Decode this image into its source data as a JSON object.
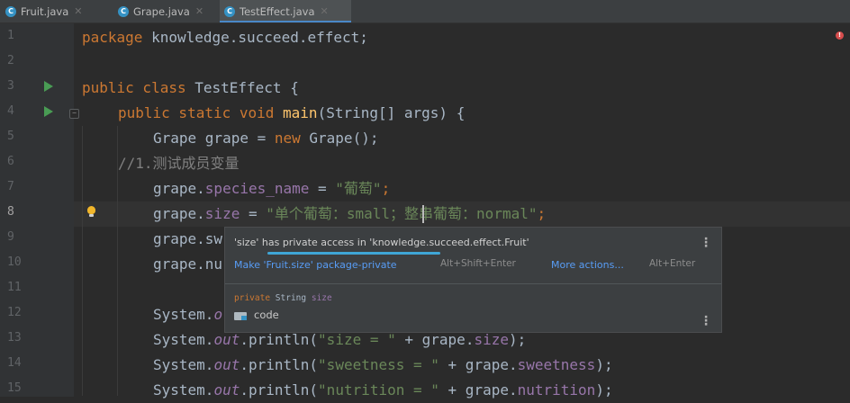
{
  "tabs": [
    {
      "label": "Fruit.java",
      "icon": "c-class-icon",
      "active": false
    },
    {
      "label": "Grape.java",
      "icon": "c-class-icon",
      "active": false
    },
    {
      "label": "TestEffect.java",
      "icon": "c-class-icon",
      "active": true
    }
  ],
  "line_numbers": [
    "1",
    "2",
    "3",
    "4",
    "5",
    "6",
    "7",
    "8",
    "9",
    "10",
    "11",
    "12",
    "13",
    "14",
    "15"
  ],
  "current_line": "8",
  "code": {
    "l1_kw": "package",
    "l1_rest": " knowledge.succeed.effect;",
    "l3_kw": "public class",
    "l3_rest": " TestEffect {",
    "l4_kw1": "public static void",
    "l4_fn": "main",
    "l4_rest": "(String[] args) {",
    "l5_a": "Grape grape = ",
    "l5_kw": "new",
    "l5_b": " Grape();",
    "l6_cmt": "//1.测试成员变量",
    "l7_a": "grape.",
    "l7_fld": "species_name",
    "l7_b": " = ",
    "l7_str": "\"葡萄\"",
    "l7_c": ";",
    "l8_a": "grape.",
    "l8_fld": "size",
    "l8_b": " = ",
    "l8_str1": "\"单个葡萄：small；",
    "l8_str2": "整串葡萄：normal\"",
    "l8_c": ";",
    "l9_a": "grape.sw",
    "l10_a": "grape.nu",
    "l12_a": "System.",
    "l12_out": "o",
    "l13_a": "System.",
    "l13_out": "out",
    "l13_b": ".println(",
    "l13_str": "\"size = \"",
    "l13_c": " + grape.",
    "l13_fld": "size",
    "l13_d": ");",
    "l14_a": "System.",
    "l14_out": "out",
    "l14_b": ".println(",
    "l14_str": "\"sweetness = \"",
    "l14_c": " + grape.",
    "l14_fld": "sweetness",
    "l14_d": ");",
    "l15_a": "System.",
    "l15_out": "out",
    "l15_b": ".println(",
    "l15_str": "\"nutrition = \"",
    "l15_c": " + grape.",
    "l15_fld": "nutrition",
    "l15_d": ");"
  },
  "error_indicator": "!",
  "popup": {
    "message_a": "'size' ",
    "message_u": "has private access",
    "message_b": " in 'knowledge.succeed.effect.Fruit'",
    "action1": "Make 'Fruit.size' package-private",
    "action1_key": "Alt+Shift+Enter",
    "action2": "More actions...",
    "action2_key": "Alt+Enter",
    "decl_kw": "private",
    "decl_type": "String",
    "decl_field": "size",
    "location": "code",
    "more_icon": "vertical-dots-icon"
  },
  "colors": {
    "background": "#2b2b2b",
    "keyword": "#cc7832",
    "string": "#6a8759",
    "field": "#9876aa",
    "method": "#ffc66d",
    "link": "#589df6"
  }
}
